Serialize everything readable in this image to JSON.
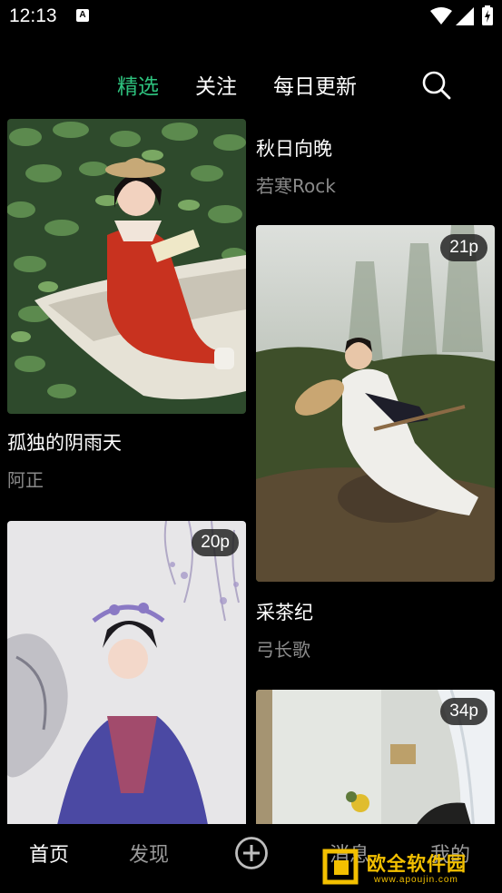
{
  "status_bar": {
    "time": "12:13",
    "notification_icon": "A"
  },
  "tabs": [
    {
      "label": "精选",
      "active": true
    },
    {
      "label": "关注",
      "active": false
    },
    {
      "label": "每日更新",
      "active": false
    }
  ],
  "colors": {
    "accent": "#2ec27e",
    "muted": "#8a8a8a"
  },
  "feed": {
    "left": [
      {
        "title": "孤独的阴雨天",
        "author": "阿正",
        "badge": ""
      },
      {
        "title": "",
        "author": "",
        "badge": "20p"
      }
    ],
    "right": [
      {
        "title": "秋日向晚",
        "author": "若寒Rock",
        "badge": ""
      },
      {
        "title": "采茶纪",
        "author": "弓长歌",
        "badge": "21p"
      },
      {
        "title": "",
        "author": "",
        "badge": "34p"
      }
    ]
  },
  "bottom_nav": [
    {
      "label": "首页",
      "active": true
    },
    {
      "label": "发现",
      "active": false
    },
    {
      "label": "消息",
      "active": false
    },
    {
      "label": "我的",
      "active": false
    }
  ],
  "watermark": {
    "text": "欧全软件园",
    "url": "www.apoujin.com"
  }
}
